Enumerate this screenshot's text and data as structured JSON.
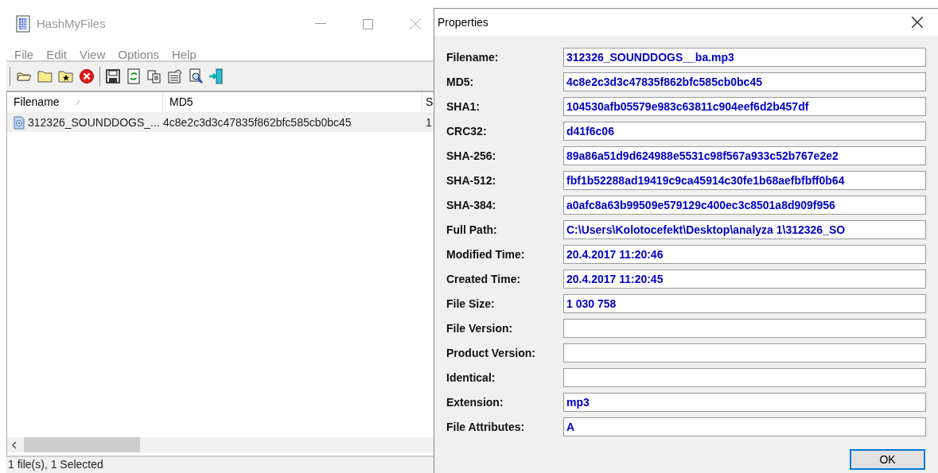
{
  "main_window": {
    "title": "HashMyFiles",
    "menu": [
      "File",
      "Edit",
      "View",
      "Options",
      "Help"
    ],
    "table": {
      "columns": [
        "Filename",
        "MD5",
        "S"
      ],
      "rows": [
        {
          "cells": [
            "312326_SOUNDDOGS_...",
            "4c8e2c3d3c47835f862bfc585cb0bc45",
            "1"
          ],
          "selected": true
        }
      ]
    },
    "status_bar": "1 file(s), 1 Selected"
  },
  "dialog": {
    "title": "Properties",
    "fields": [
      {
        "label": "Filename:",
        "value": "312326_SOUNDDOGS__ba.mp3"
      },
      {
        "label": "MD5:",
        "value": "4c8e2c3d3c47835f862bfc585cb0bc45"
      },
      {
        "label": "SHA1:",
        "value": "104530afb05579e983c63811c904eef6d2b457df"
      },
      {
        "label": "CRC32:",
        "value": "d41f6c06"
      },
      {
        "label": "SHA-256:",
        "value": "89a86a51d9d624988e5531c98f567a933c52b767e2e2"
      },
      {
        "label": "SHA-512:",
        "value": "fbf1b52288ad19419c9ca45914c30fe1b68aefbfbff0b64"
      },
      {
        "label": "SHA-384:",
        "value": "a0afc8a63b99509e579129c400ec3c8501a8d909f956"
      },
      {
        "label": "Full Path:",
        "value": "C:\\Users\\Kolotocefekt\\Desktop\\analyza 1\\312326_SO"
      },
      {
        "label": "Modified Time:",
        "value": "20.4.2017 11:20:46"
      },
      {
        "label": "Created Time:",
        "value": "20.4.2017 11:20:45"
      },
      {
        "label": "File Size:",
        "value": "1 030 758"
      },
      {
        "label": "File Version:"
      },
      {
        "label": "Product Version:"
      },
      {
        "label": "Identical:"
      },
      {
        "label": "Extension:",
        "value": "mp3"
      },
      {
        "label": "File Attributes:",
        "value": "A"
      }
    ],
    "button": "OK"
  }
}
